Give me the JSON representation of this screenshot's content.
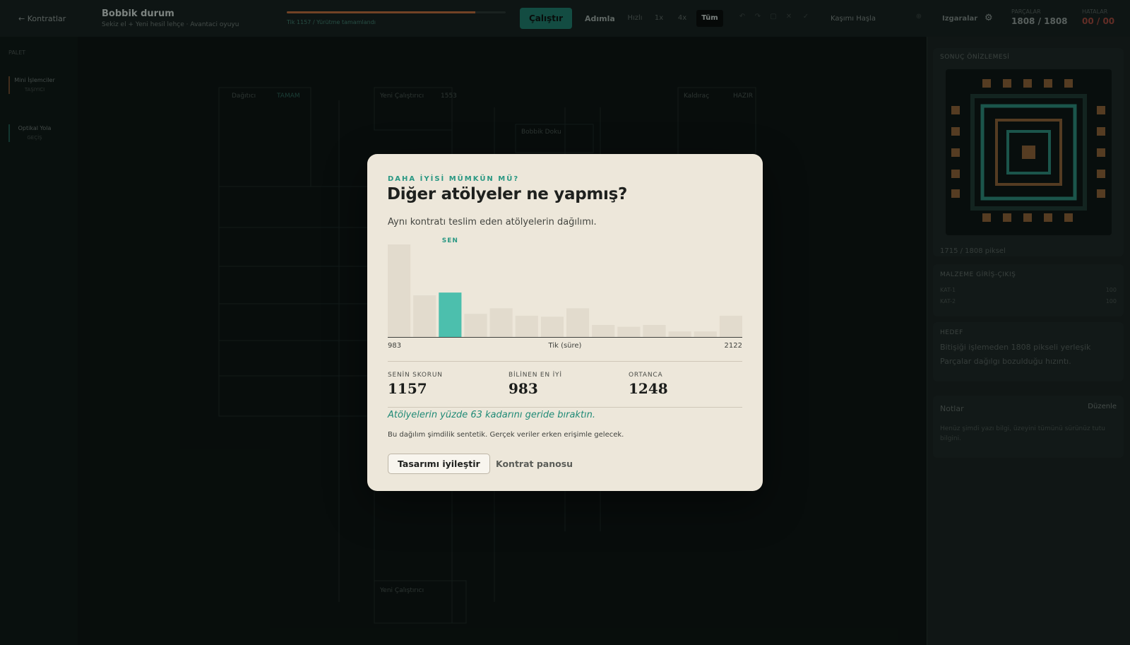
{
  "topbar": {
    "back_label": "← Kontratlar",
    "title": "Bobbik durum",
    "subtitle": "Sekiz el + Yeni hesil lehçe · Avantaci oyuyu",
    "progress_label": "Tik 1157 / Yürütme tamamlandı",
    "progress_fraction": 0.86,
    "run_label": "Çalıştır",
    "step_label": "Adımla",
    "speeds": [
      "Hızlı",
      "1x",
      "4x",
      "Tüm"
    ],
    "center_view_label": "Kaşımı Haşla",
    "grid_label": "Izgaralar",
    "settings_icon": "gear-icon",
    "stat1_label": "PARÇALAR",
    "stat1_value": "1808 / 1808",
    "stat2_label": "HATALAR",
    "stat2_value": "00 / 00"
  },
  "leftrail": {
    "label": "PALET",
    "items": [
      {
        "label": "Mini İşlemciler",
        "sub": "TAŞIYICI"
      },
      {
        "label": "Optikal Yola",
        "sub": "GEÇİŞ"
      }
    ]
  },
  "canvas": {
    "node_titles": [
      "Dağıtıcı",
      "Yeni Çalıştırıcı",
      "Kaldıraç",
      "Bobbik Doku",
      "Yeni Çalıştırıcı"
    ],
    "node_badges": [
      "TAMAM",
      "1553",
      "HAZIR"
    ]
  },
  "rightpanel": {
    "preview_title": "SONUÇ ÖNİZLEMESİ",
    "preview_caption": "1715 / 1808 piksel",
    "io_title": "MALZEME GİRİŞ-ÇIKIŞ",
    "io_rows": [
      {
        "label": "KAT-1",
        "value": "100"
      },
      {
        "label": "KAT-2",
        "value": "100"
      }
    ],
    "goal_title": "HEDEF",
    "goal_text": "Bitişiği işlemeden 1808 pikseli yerleşik Parçalar dağılgı bozulduğu hızıntı.",
    "notes_title": "Notlar",
    "notes_button": "Düzenle",
    "notes_text": "Henüz şimdi yazı bilgi, üzeyini tümünü sürünüz tutu bilgini."
  },
  "modal": {
    "eyebrow": "DAHA İYİSİ MÜMKÜN MÜ?",
    "title": "Diğer atölyeler ne yapmış?",
    "description": "Aynı kontratı teslim eden atölyelerin dağılımı.",
    "you_marker": "SEN",
    "axis_min": "983",
    "axis_max": "2122",
    "axis_label": "Tik (süre)",
    "stats": [
      {
        "label": "SENİN SKORUN",
        "value": "1157"
      },
      {
        "label": "BİLİNEN EN İYİ",
        "value": "983"
      },
      {
        "label": "ORTANCA",
        "value": "1248"
      }
    ],
    "beat_text": "Atölyelerin yüzde 63 kadarını geride bıraktın.",
    "note": "Bu dağılım şimdilik sentetik. Gerçek veriler erken erişimle gelecek.",
    "primary_button": "Tasarımı iyileştir",
    "secondary_button": "Kontrat panosu"
  },
  "colors": {
    "accent": "#4cbfad",
    "accent_text": "#2a9883",
    "bar": "#e2dbcd",
    "modal_bg": "#ede7da",
    "app_bg": "#0f1917"
  },
  "chart_data": {
    "type": "bar",
    "title": "",
    "xlabel": "Tik (süre)",
    "ylabel": "",
    "x_range": [
      983,
      2122
    ],
    "values": [
      100,
      45,
      48,
      25,
      31,
      23,
      22,
      31,
      13,
      11,
      13,
      6,
      6,
      23
    ],
    "highlight_index": 2,
    "highlight_label": "SEN"
  }
}
